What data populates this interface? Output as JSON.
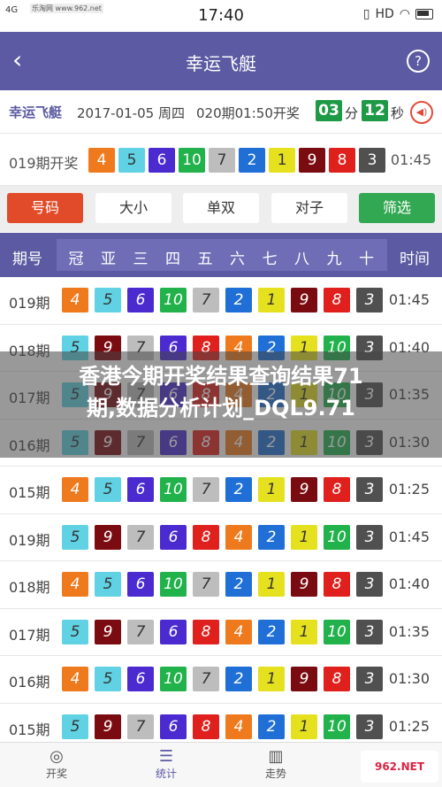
{
  "status": {
    "network": "4G",
    "site": "乐淘网 www.962.net",
    "time": "17:40"
  },
  "titlebar": {
    "title": "幸运飞艇",
    "help": "?"
  },
  "info": {
    "game": "幸运飞艇",
    "date": "2017-01-05  周四",
    "period": "020期01:50开奖",
    "min": "03",
    "min_label": "分",
    "sec": "12",
    "sec_label": "秒"
  },
  "last": {
    "label": "019期开奖",
    "numbers": [
      4,
      5,
      6,
      10,
      7,
      2,
      1,
      9,
      8,
      3
    ],
    "time": "01:45"
  },
  "filters": [
    {
      "label": "号码",
      "style": "red"
    },
    {
      "label": "大小",
      "style": ""
    },
    {
      "label": "单双",
      "style": ""
    },
    {
      "label": "对子",
      "style": ""
    },
    {
      "label": "筛选",
      "style": "green"
    }
  ],
  "header": {
    "period": "期号",
    "positions": [
      "冠",
      "亚",
      "三",
      "四",
      "五",
      "六",
      "七",
      "八",
      "九",
      "十"
    ],
    "time": "时间"
  },
  "rows": [
    {
      "period": "019期",
      "numbers": [
        4,
        5,
        6,
        10,
        7,
        2,
        1,
        9,
        8,
        3
      ],
      "time": "01:45"
    },
    {
      "period": "018期",
      "numbers": [
        5,
        9,
        7,
        6,
        8,
        4,
        2,
        1,
        10,
        3
      ],
      "time": "01:40"
    },
    {
      "period": "017期",
      "numbers": [
        5,
        9,
        7,
        6,
        8,
        4,
        2,
        1,
        10,
        3
      ],
      "time": "01:35"
    },
    {
      "period": "016期",
      "numbers": [
        5,
        9,
        7,
        6,
        8,
        4,
        2,
        1,
        10,
        3
      ],
      "time": "01:30"
    },
    {
      "period": "015期",
      "numbers": [
        4,
        5,
        6,
        10,
        7,
        2,
        1,
        9,
        8,
        3
      ],
      "time": "01:25"
    },
    {
      "period": "019期",
      "numbers": [
        5,
        9,
        7,
        6,
        8,
        4,
        2,
        1,
        10,
        3
      ],
      "time": "01:45"
    },
    {
      "period": "018期",
      "numbers": [
        4,
        5,
        6,
        10,
        7,
        2,
        1,
        9,
        8,
        3
      ],
      "time": "01:40"
    },
    {
      "period": "017期",
      "numbers": [
        5,
        9,
        7,
        6,
        8,
        4,
        2,
        1,
        10,
        3
      ],
      "time": "01:35"
    },
    {
      "period": "016期",
      "numbers": [
        4,
        5,
        6,
        10,
        7,
        2,
        1,
        9,
        8,
        3
      ],
      "time": "01:30"
    },
    {
      "period": "015期",
      "numbers": [
        5,
        9,
        7,
        6,
        8,
        4,
        2,
        1,
        10,
        3
      ],
      "time": "01:25"
    }
  ],
  "overlay": {
    "line1": "香港今期开奖结果查询结果71",
    "line2": "期,数据分析计划_DQL9.71"
  },
  "tabs": [
    {
      "label": "开奖",
      "icon": "lottery-icon",
      "glyph": "◎"
    },
    {
      "label": "统计",
      "icon": "statistics-icon",
      "glyph": "☰"
    },
    {
      "label": "走势",
      "icon": "trend-icon",
      "glyph": "▥"
    }
  ],
  "watermark": "962.NET"
}
